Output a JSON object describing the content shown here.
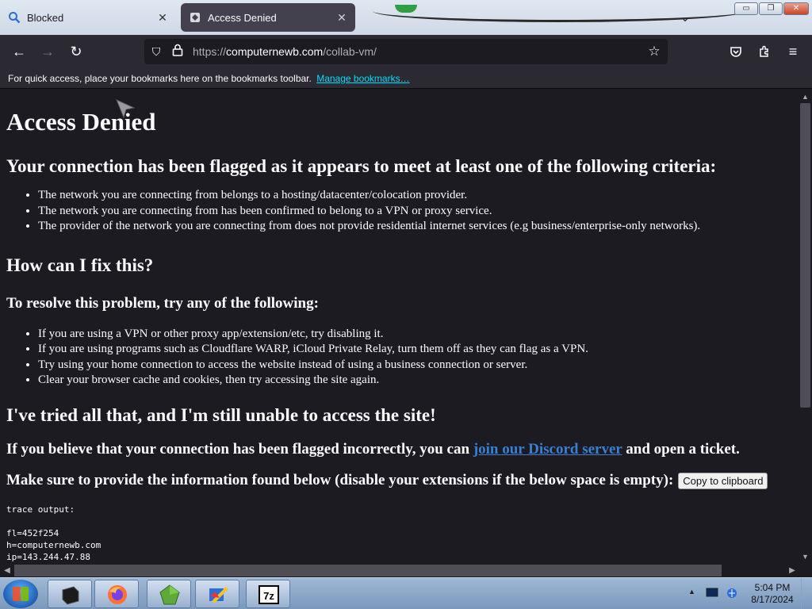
{
  "tabs": [
    {
      "label": "Blocked",
      "icon": "search-icon"
    },
    {
      "label": "Access Denied",
      "icon": "site-favicon-icon"
    }
  ],
  "window_controls": {
    "minimize": "▭",
    "maximize": "❐",
    "close": "✕"
  },
  "nav": {
    "url_prefix": "https://",
    "url_host": "computernewb.com",
    "url_path": "/collab-vm/"
  },
  "bookmarks": {
    "message": "For quick access, place your bookmarks here on the bookmarks toolbar.",
    "link": "Manage bookmarks…"
  },
  "page": {
    "title": "Access Denied",
    "criteria_heading": "Your connection has been flagged as it appears to meet at least one of the following criteria:",
    "criteria": [
      "The network you are connecting from belongs to a hosting/datacenter/colocation provider.",
      "The network you are connecting from has been confirmed to belong to a VPN or proxy service.",
      "The provider of the network you are connecting from does not provide residential internet services (e.g business/enterprise-only networks)."
    ],
    "fix_heading": "How can I fix this?",
    "resolve_heading": "To resolve this problem, try any of the following:",
    "fixes": [
      "If you are using a VPN or other proxy app/extension/etc, try disabling it.",
      "If you are using programs such as Cloudflare WARP, iCloud Private Relay, turn them off as they can flag as a VPN.",
      "Try using your home connection to access the website instead of using a business connection or server.",
      "Clear your browser cache and cookies, then try accessing the site again."
    ],
    "still_heading": "I've tried all that, and I'm still unable to access the site!",
    "discord_pre": "If you believe that your connection has been flagged incorrectly, you can ",
    "discord_link": "join our Discord server",
    "discord_post": " and open a ticket.",
    "info_text": "Make sure to provide the information found below (disable your extensions if the below space is empty):",
    "copy_button": "Copy to clipboard",
    "trace": "trace output:\n\nfl=452f254\nh=computernewb.com\nip=143.244.47.88"
  },
  "taskbar": {
    "apps": [
      "terminal-icon",
      "firefox-icon",
      "green-gem-icon",
      "image-editor-icon",
      "7zip-icon"
    ],
    "time": "5:04 PM",
    "date": "8/17/2024"
  }
}
